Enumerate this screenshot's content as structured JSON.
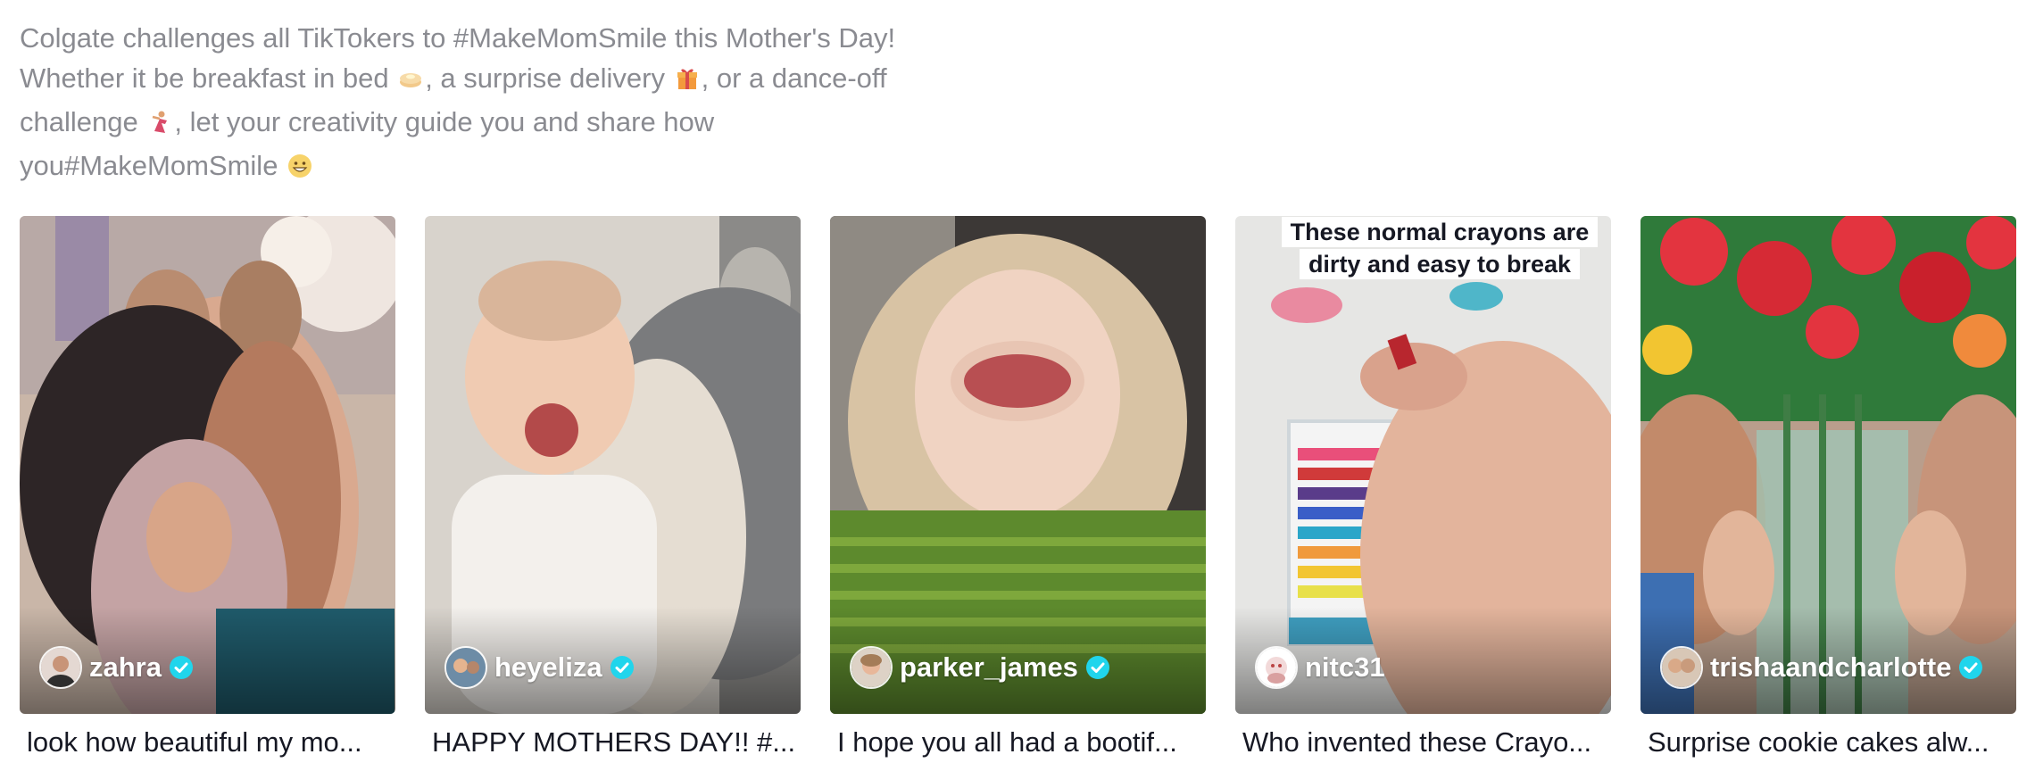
{
  "description": {
    "line1": "Colgate challenges all TikTokers to #MakeMomSmile this Mother's Day!",
    "line2a": "Whether it be breakfast in bed",
    "line2b": ", a surprise delivery",
    "line2c": ", or a dance-off",
    "line3a": "challenge",
    "line3b": ", let your creativity guide you and share how",
    "line4": "you#MakeMomSmile",
    "emoji_icons": [
      "pancakes-icon",
      "gift-icon",
      "dancer-icon",
      "grinning-face-icon"
    ]
  },
  "videos": [
    {
      "author": "zahra",
      "verified": true,
      "caption": "look how beautiful my mo..."
    },
    {
      "author": "heyeliza",
      "verified": true,
      "caption": "HAPPY MOTHERS DAY!! #..."
    },
    {
      "author": "parker_james",
      "verified": true,
      "caption": "I hope you all had a bootif..."
    },
    {
      "author": "nitc31",
      "verified": false,
      "caption": "Who invented these Crayo...",
      "overlay_text": "These normal crayons are dirty and easy to break"
    },
    {
      "author": "trishaandcharlotte",
      "verified": true,
      "caption": "Surprise cookie cakes alw..."
    }
  ],
  "colors": {
    "verified": "#20d5ec",
    "description_text": "#8a8b91"
  }
}
